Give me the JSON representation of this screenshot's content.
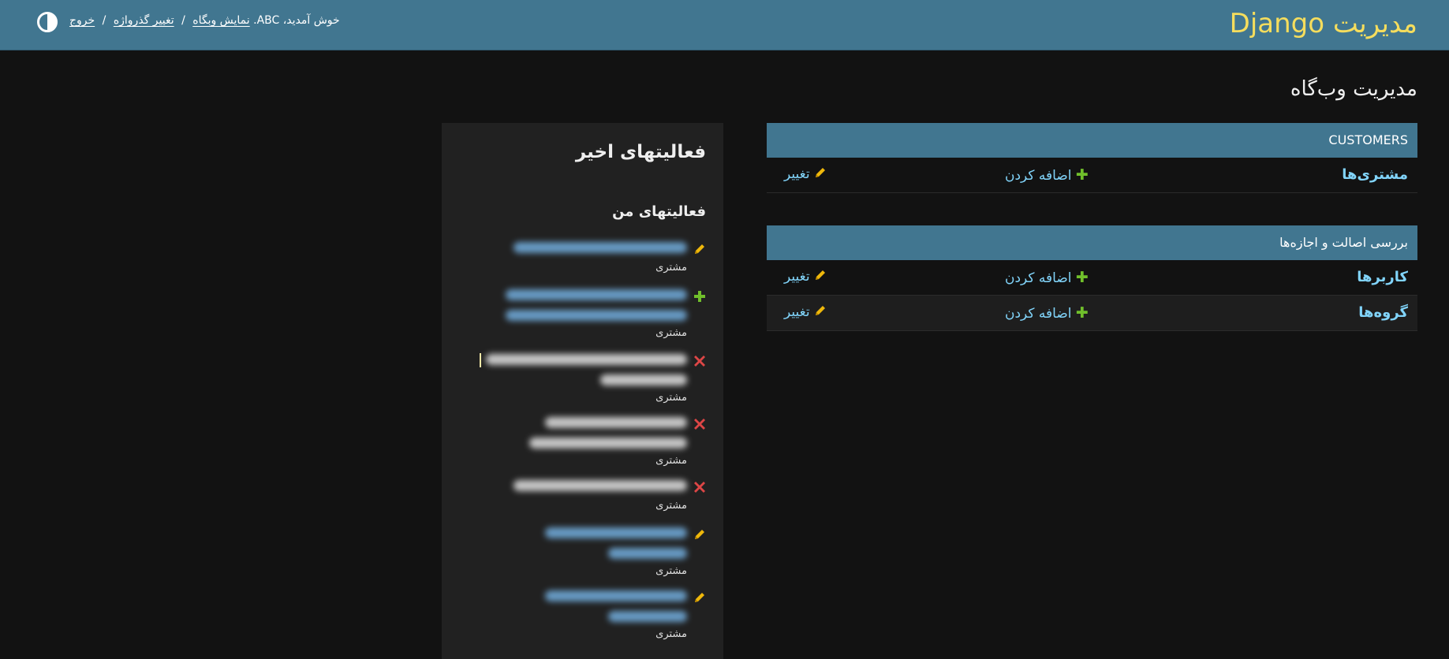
{
  "header": {
    "site_title": "مدیریت Django",
    "welcome": "خوش آمدید، ABC.",
    "view_site": "نمایش وبگاه",
    "change_password": "تغییر گذرواژه",
    "logout": "خروج",
    "separator": "/",
    "bg_color": "#417690",
    "title_color": "#f5dd5d"
  },
  "page": {
    "heading": "مدیریت وب‌گاه"
  },
  "apps": [
    {
      "caption": "CUSTOMERS",
      "models": [
        {
          "name": "مشتری‌ها",
          "add": "اضافه کردن",
          "change": "تغییر"
        }
      ]
    },
    {
      "caption": "بررسی اصالت و اجازه‌ها",
      "models": [
        {
          "name": "کاربرها",
          "add": "اضافه کردن",
          "change": "تغییر"
        },
        {
          "name": "گروه‌ها",
          "add": "اضافه کردن",
          "change": "تغییر"
        }
      ]
    }
  ],
  "recent_actions": {
    "title": "فعالیتهای اخیر",
    "subtitle": "فعالیتهای من",
    "items": [
      {
        "type": "change",
        "content_type": "مشتری"
      },
      {
        "type": "add",
        "content_type": "مشتری"
      },
      {
        "type": "delete",
        "content_type": "مشتری"
      },
      {
        "type": "delete",
        "content_type": "مشتری"
      },
      {
        "type": "delete",
        "content_type": "مشتری"
      },
      {
        "type": "change",
        "content_type": "مشتری"
      },
      {
        "type": "change",
        "content_type": "مشتری"
      }
    ]
  },
  "colors": {
    "link": "#81d4fa",
    "add_icon": "#70bf2b",
    "change_icon": "#efb80b",
    "delete_icon": "#dd4646",
    "background": "#121212"
  }
}
